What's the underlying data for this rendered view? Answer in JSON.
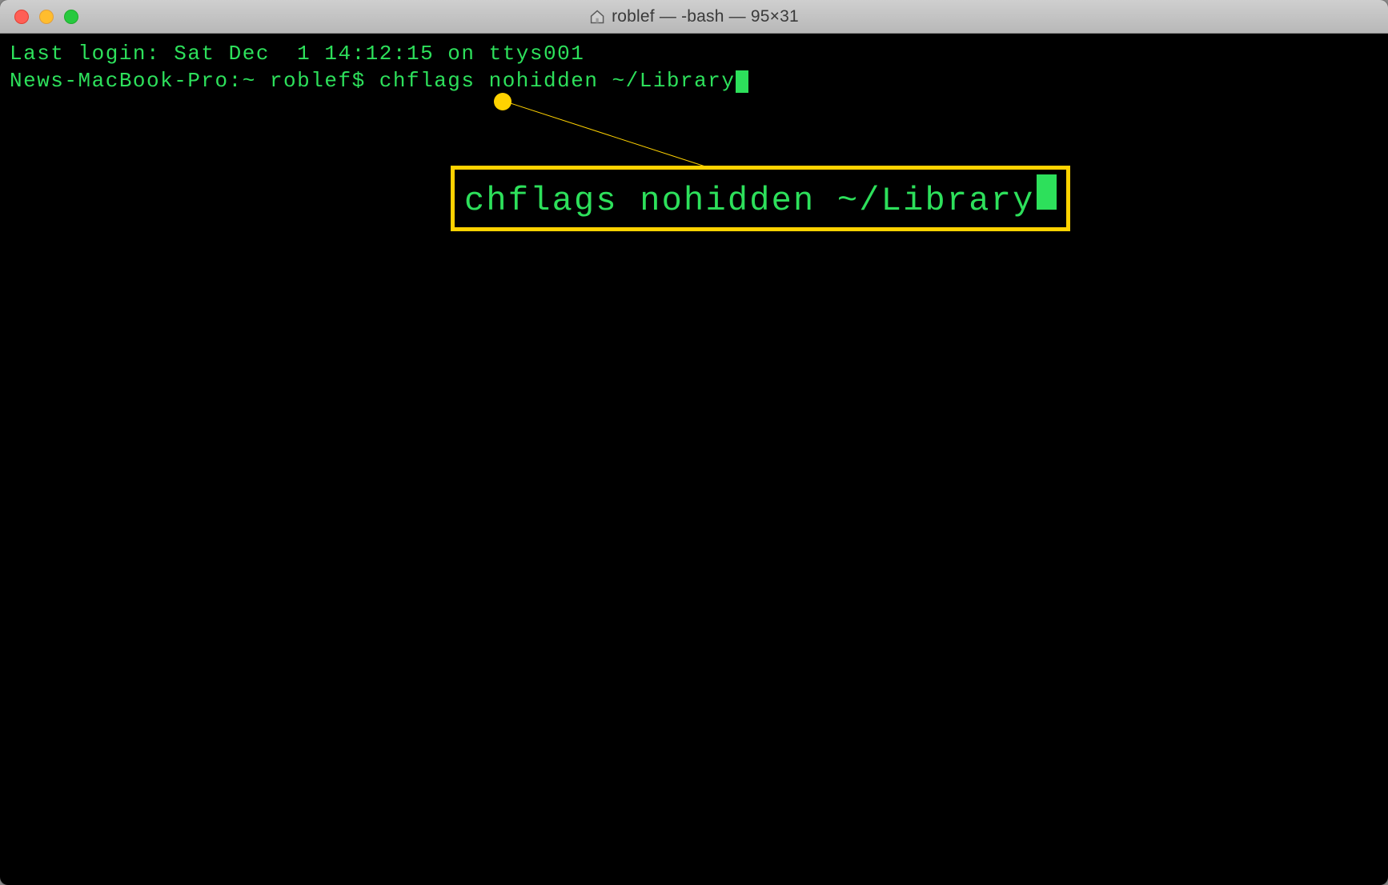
{
  "window": {
    "title": "roblef — -bash — 95×31"
  },
  "terminal": {
    "last_login": "Last login: Sat Dec  1 14:12:15 on ttys001",
    "prompt": "News-MacBook-Pro:~ roblef$ ",
    "command": "chflags nohidden ~/Library"
  },
  "callout": {
    "text": "chflags nohidden ~/Library"
  }
}
